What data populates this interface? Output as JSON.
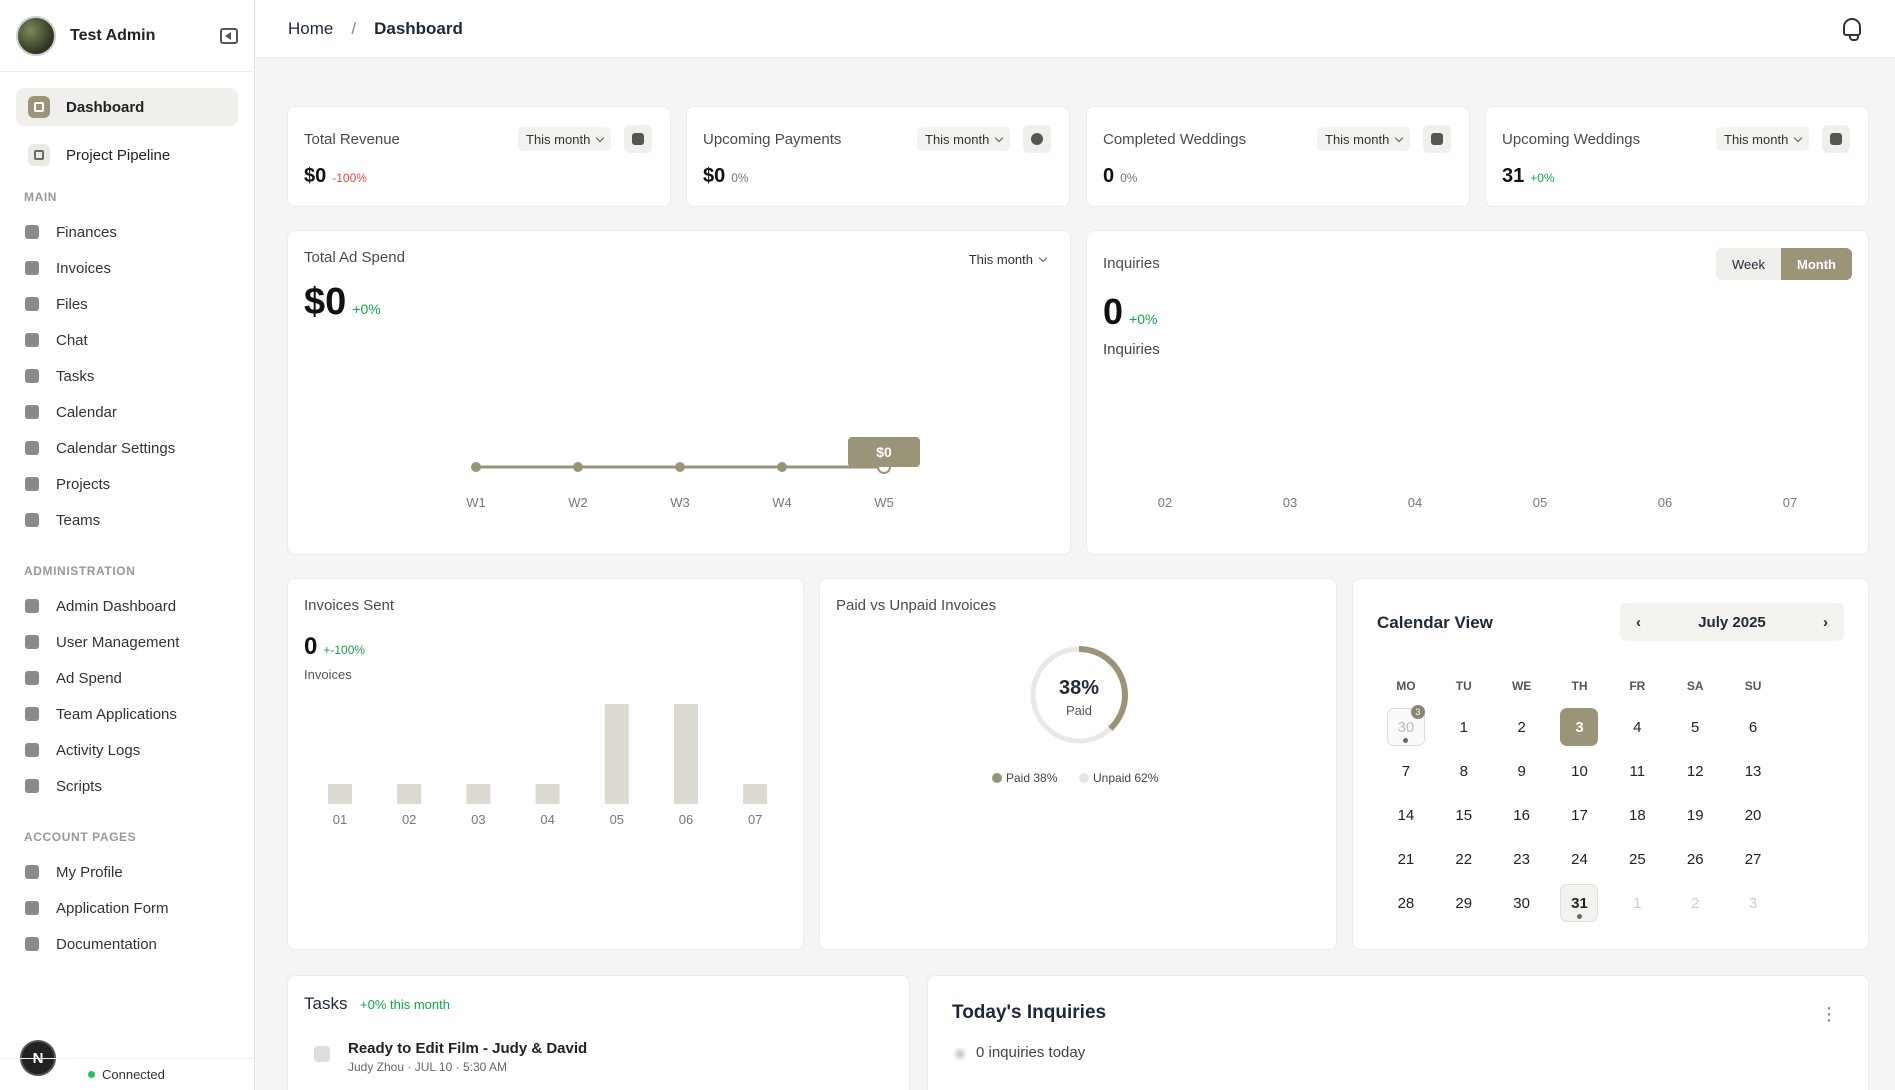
{
  "user": {
    "name": "Test Admin"
  },
  "nav_top": [
    {
      "label": "Dashboard"
    },
    {
      "label": "Project Pipeline"
    }
  ],
  "sections": {
    "main": "MAIN",
    "admin": "ADMINISTRATION",
    "account": "ACCOUNT PAGES"
  },
  "main_items": [
    "Finances",
    "Invoices",
    "Files",
    "Chat",
    "Tasks",
    "Calendar",
    "Calendar Settings",
    "Projects",
    "Teams"
  ],
  "admin_items": [
    "Admin Dashboard",
    "User Management",
    "Ad Spend",
    "Team Applications",
    "Activity Logs",
    "Scripts"
  ],
  "account_items": [
    "My Profile",
    "Application Form",
    "Documentation"
  ],
  "status": {
    "label": "Connected",
    "badge": "N"
  },
  "breadcrumb": {
    "home": "Home",
    "sep": "/",
    "current": "Dashboard"
  },
  "stats": [
    {
      "title": "Total Revenue",
      "period": "This month",
      "value": "$0",
      "change": "-100%"
    },
    {
      "title": "Upcoming Payments",
      "period": "This month",
      "value": "$0",
      "change": "0%"
    },
    {
      "title": "Completed Weddings",
      "period": "This month",
      "value": "0",
      "change": "0%"
    },
    {
      "title": "Upcoming Weddings",
      "period": "This month",
      "value": "31",
      "change": "+0%"
    }
  ],
  "adspend": {
    "title": "Total Ad Spend",
    "period": "This month",
    "value": "$0",
    "change": "+0%",
    "tooltip": "$0"
  },
  "inquiries": {
    "title": "Inquiries",
    "value": "0",
    "change": "+0%",
    "sub": "Inquiries",
    "week": "Week",
    "month": "Month"
  },
  "invoices_sent": {
    "title": "Invoices Sent",
    "value": "0",
    "change": "+-100%",
    "sub": "Invoices"
  },
  "paid_unpaid": {
    "title": "Paid vs Unpaid Invoices",
    "pct": "38%",
    "pct_label": "Paid",
    "paid_legend": "Paid 38%",
    "unpaid_legend": "Unpaid 62%"
  },
  "calendar": {
    "title": "Calendar View",
    "month": "July 2025",
    "prev": "‹",
    "next": "›",
    "dow": [
      "MO",
      "TU",
      "WE",
      "TH",
      "FR",
      "SA",
      "SU"
    ],
    "badge": "3"
  },
  "tasks": {
    "title": "Tasks",
    "change": "+0% this month",
    "item_title": "Ready to Edit Film - Judy & David",
    "item_meta": "Judy Zhou · JUL 10 · 5:30 AM"
  },
  "today": {
    "title": "Today's Inquiries",
    "empty": "0 inquiries today"
  },
  "chart_data": [
    {
      "type": "line",
      "title": "Total Ad Spend",
      "x": [
        "W1",
        "W2",
        "W3",
        "W4",
        "W5"
      ],
      "series": [
        {
          "values": [
            0,
            0,
            0,
            0,
            0
          ]
        }
      ]
    },
    {
      "type": "bar",
      "title": "Inquiries",
      "categories": [
        "02",
        "03",
        "04",
        "05",
        "06",
        "07"
      ],
      "values": [
        0,
        0,
        0,
        0,
        0,
        0
      ]
    },
    {
      "type": "bar",
      "title": "Invoices Sent",
      "categories": [
        "01",
        "02",
        "03",
        "04",
        "05",
        "06",
        "07"
      ],
      "values": [
        0.2,
        0.2,
        0.2,
        0.2,
        1,
        1,
        0.2
      ]
    },
    {
      "type": "pie",
      "title": "Paid vs Unpaid Invoices",
      "categories": [
        "Paid",
        "Unpaid"
      ],
      "values": [
        38,
        62
      ]
    }
  ]
}
